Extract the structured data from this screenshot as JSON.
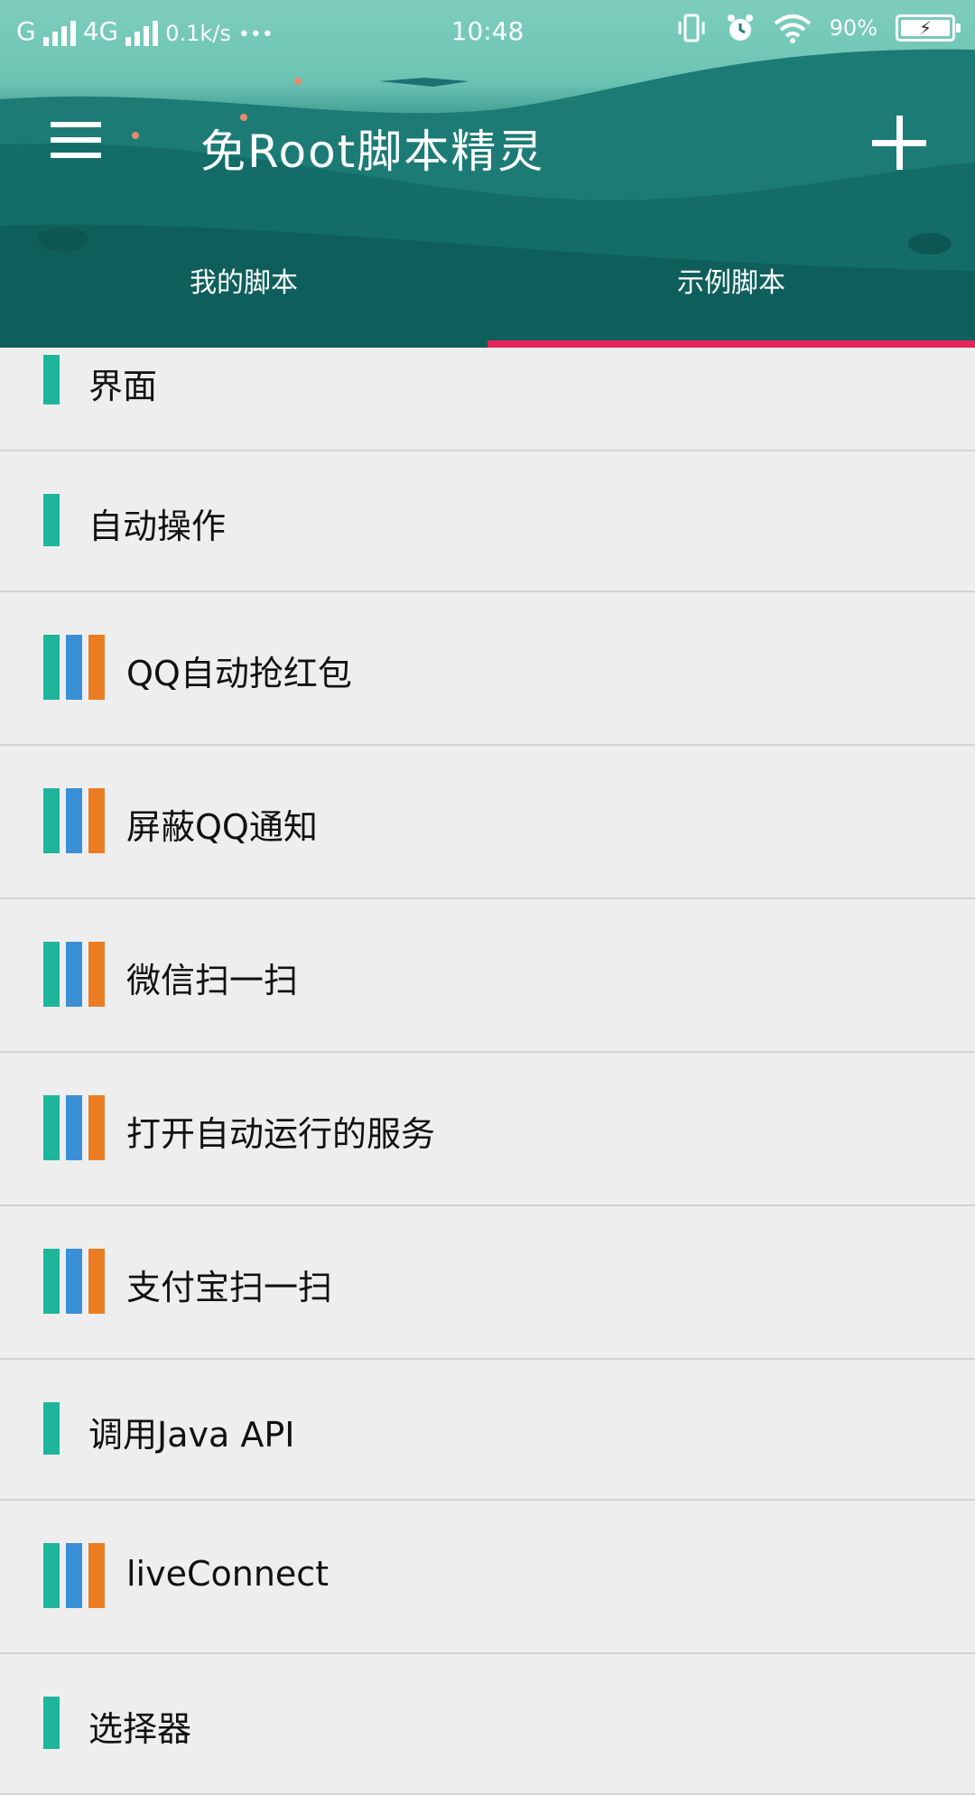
{
  "status_bar": {
    "carrier1": "G",
    "carrier2": "4G",
    "net_speed": "0.1k/s",
    "more": "•••",
    "time": "10:48",
    "battery_percent": "90%",
    "battery_level": 0.9
  },
  "app": {
    "title": "免Root脚本精灵"
  },
  "tabs": [
    {
      "label": "我的脚本",
      "selected": false
    },
    {
      "label": "示例脚本",
      "selected": true
    }
  ],
  "colors": {
    "accent_indicator": "#e0265a",
    "bar_green": "#1fb59a",
    "bar_blue": "#3b8fd4",
    "bar_orange": "#ea7d23"
  },
  "items": [
    {
      "label": "界面",
      "type": "single"
    },
    {
      "label": "自动操作",
      "type": "single"
    },
    {
      "label": "QQ自动抢红包",
      "type": "triple"
    },
    {
      "label": "屏蔽QQ通知",
      "type": "triple"
    },
    {
      "label": "微信扫一扫",
      "type": "triple"
    },
    {
      "label": "打开自动运行的服务",
      "type": "triple"
    },
    {
      "label": "支付宝扫一扫",
      "type": "triple"
    },
    {
      "label": "调用Java API",
      "type": "single"
    },
    {
      "label": "liveConnect",
      "type": "triple"
    },
    {
      "label": "选择器",
      "type": "single"
    }
  ]
}
